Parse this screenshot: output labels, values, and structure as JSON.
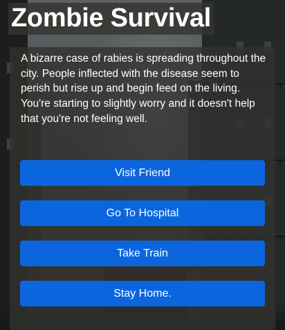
{
  "game": {
    "title": "Zombie Survival",
    "story": "A bizarre case of rabies is spreading throughout the city. People inflected with the disease seem to perish but rise up and begin feed on the living. You're starting to slightly worry and it doesn't help that you're not feeling well.",
    "choices": [
      {
        "label": "Visit Friend"
      },
      {
        "label": "Go To Hospital"
      },
      {
        "label": "Take Train"
      },
      {
        "label": "Stay Home."
      }
    ]
  },
  "theme": {
    "button_color": "#0b66de",
    "text_color": "#ffffff",
    "panel_color": "#32322e"
  }
}
